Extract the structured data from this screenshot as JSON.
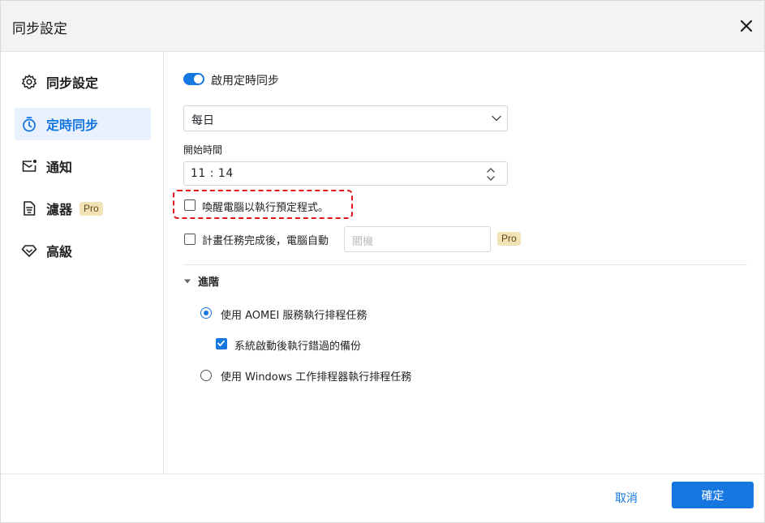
{
  "window": {
    "title": "同步設定",
    "close_icon": "close-icon"
  },
  "sidebar": {
    "items": [
      {
        "label": "同步設定",
        "icon": "gear-icon",
        "active": false
      },
      {
        "label": "定時同步",
        "icon": "stopwatch-icon",
        "active": true
      },
      {
        "label": "通知",
        "icon": "mail-notification-icon",
        "active": false
      },
      {
        "label": "濾器",
        "icon": "filter-document-icon",
        "active": false,
        "badge": "Pro"
      },
      {
        "label": "高級",
        "icon": "diamond-icon",
        "active": false
      }
    ]
  },
  "schedule": {
    "enable_label": "啟用定時同步",
    "enabled": true,
    "frequency_value": "每日",
    "start_time_label": "開始時間",
    "start_time_value": "11 : 14",
    "wake_label": "喚醒電腦以執行預定程式。",
    "wake_checked": false,
    "after_complete_label": "計畫任務完成後，電腦自動",
    "after_complete_checked": false,
    "after_complete_placeholder": "關機",
    "after_complete_badge": "Pro"
  },
  "advanced": {
    "header": "進階",
    "option_service": "使用 AOMEI 服務執行排程任務",
    "option_service_selected": true,
    "run_missed_label": "系統啟動後執行錯過的備份",
    "run_missed_checked": true,
    "option_windows": "使用 Windows 工作排程器執行排程任務",
    "option_windows_selected": false
  },
  "footer": {
    "cancel_label": "取消",
    "ok_label": "確定"
  },
  "colors": {
    "accent": "#1677e0",
    "highlight": "#e0161b",
    "pro_badge": "#f2e3b6"
  }
}
